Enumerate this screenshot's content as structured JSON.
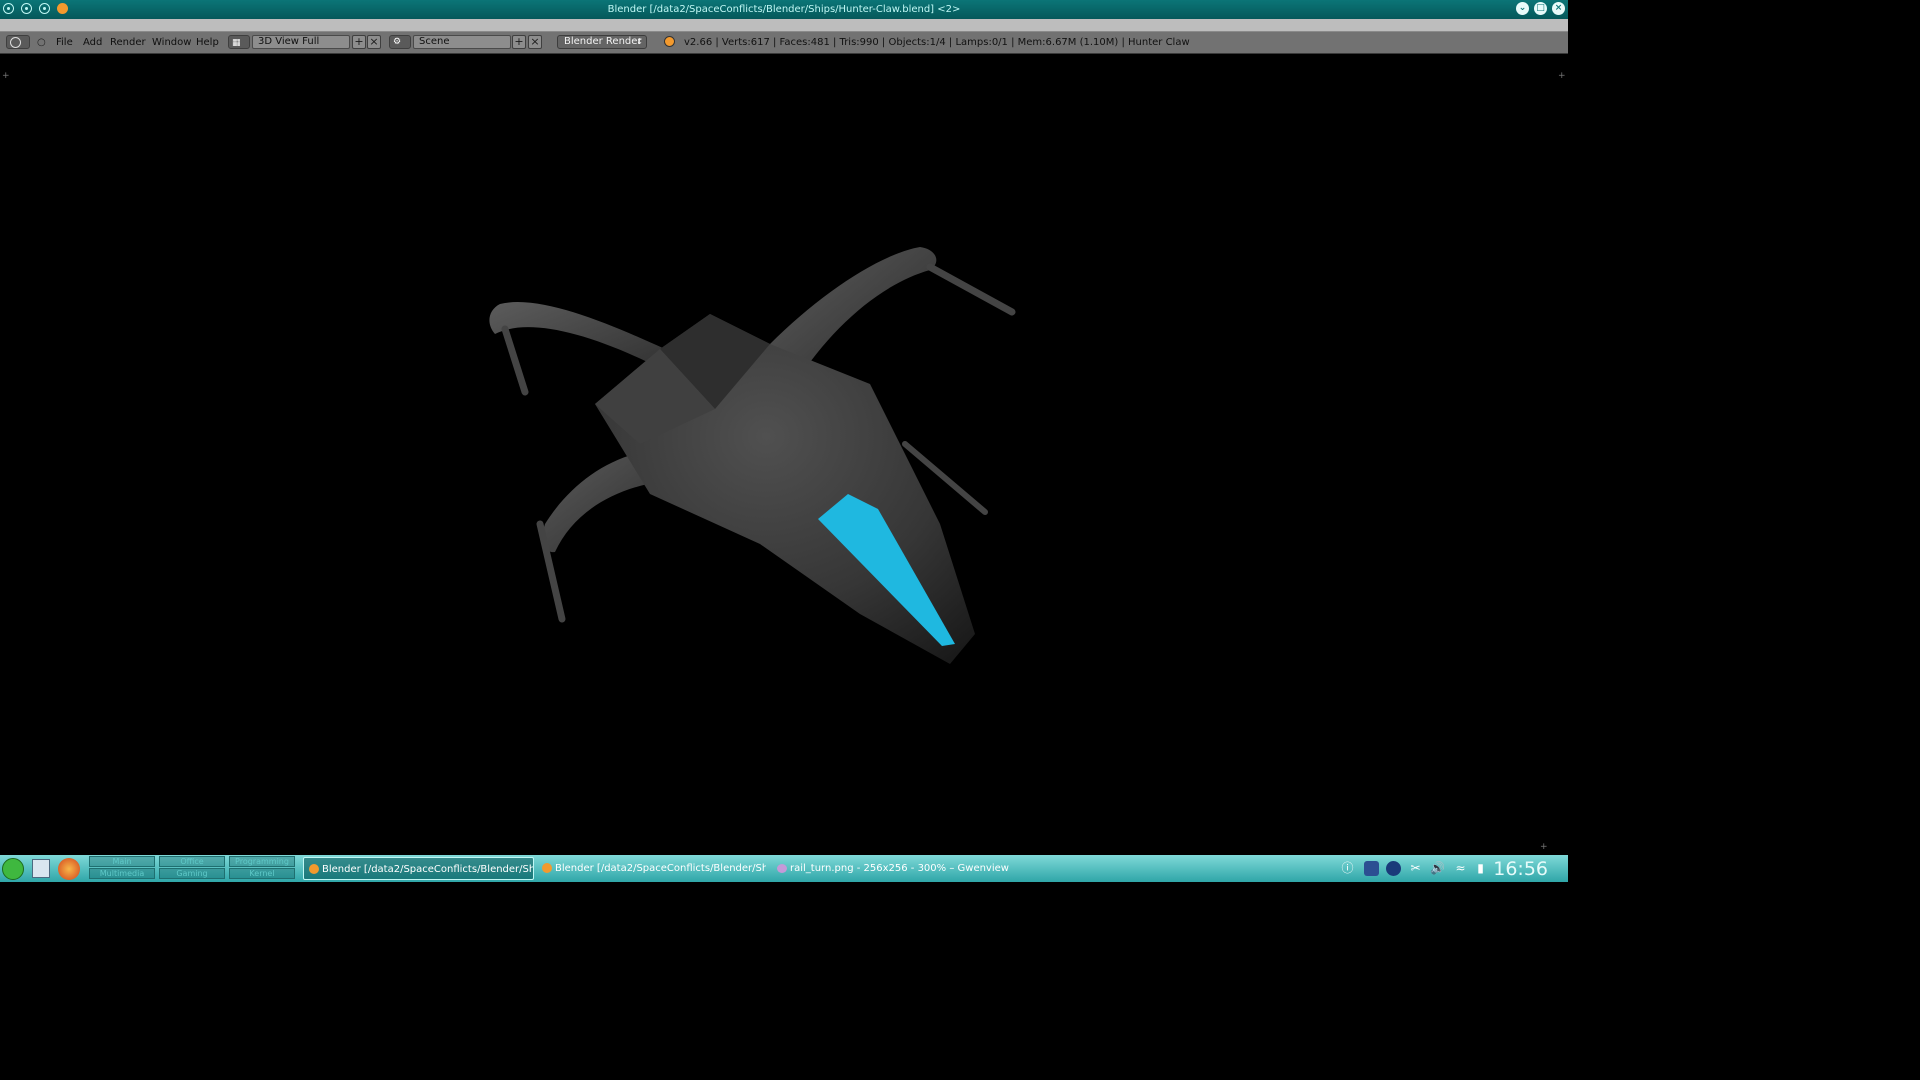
{
  "window": {
    "title": "Blender [/data2/SpaceConflicts/Blender/Ships/Hunter-Claw.blend] <2>"
  },
  "header": {
    "menus": [
      "File",
      "Add",
      "Render",
      "Window",
      "Help"
    ],
    "screen_layout": "3D View Full",
    "scene": "Scene",
    "render_engine": "Blender Render",
    "status": "v2.66 | Verts:617 | Faces:481 | Tris:990 | Objects:1/4 | Lamps:0/1 | Mem:6.67M (1.10M) | Hunter Claw"
  },
  "taskbar": {
    "pager": [
      "Main",
      "Office",
      "Programming",
      "Multimedia",
      "Gaming",
      "Kernel"
    ],
    "tasks": [
      "Blender [/data2/SpaceConflicts/Blender/Shi",
      "Blender [/data2/SpaceConflicts/Blender/Shi",
      "rail_turn.png - 256x256 - 300% – Gwenview"
    ],
    "clock": "16:56"
  },
  "colors": {
    "accent": "#0b7577",
    "ship_body": "#3a3a3a",
    "ship_stripe": "#1fb8e0"
  },
  "icons": [
    "blender-icon",
    "close-icon",
    "minimize-icon",
    "maximize-icon",
    "firefox-icon",
    "file-manager-icon",
    "app-menu-icon"
  ]
}
